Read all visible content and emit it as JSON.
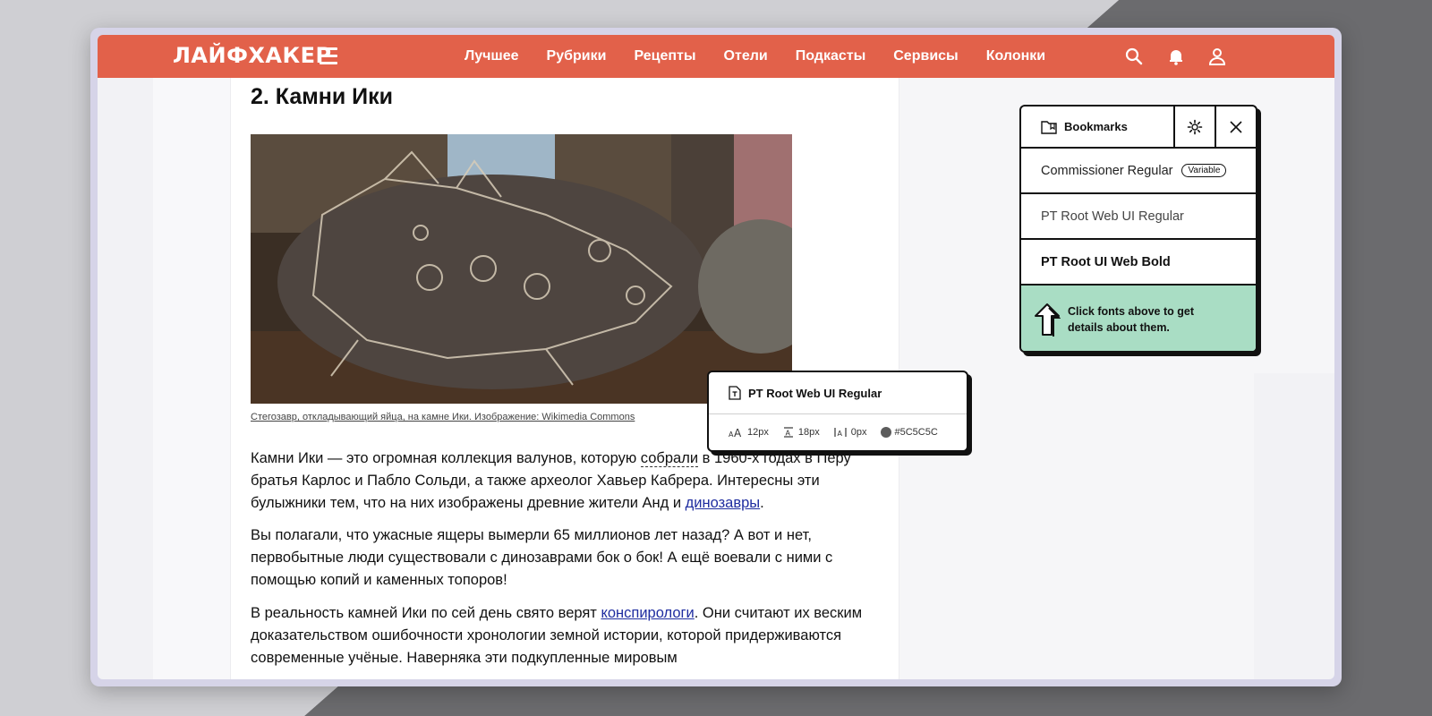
{
  "header": {
    "logo": "ЛАЙФХАКЕР",
    "nav": [
      "Лучшее",
      "Рубрики",
      "Рецепты",
      "Отели",
      "Подкасты",
      "Сервисы",
      "Колонки"
    ],
    "icons": [
      "search-icon",
      "bell-icon",
      "user-icon"
    ],
    "brand_color": "#e2614a"
  },
  "article": {
    "heading": "2. Камни Ики",
    "caption": "Стегозавр, откладывающий яйца, на камне Ики. Изображение: Wikimedia Commons",
    "p1": {
      "a": "Камни Ики — это огромная коллекция валунов, которую ",
      "dotted": "собрали",
      "b": " в 1960-х годах в Перу братья Карлос и Пабло Сольди, а также археолог Хавьер Кабрера. Интересны эти булыжники тем, что на них изображены древние жители Анд и ",
      "link": "динозавры",
      "c": "."
    },
    "p2": "Вы полагали, что ужасные ящеры вымерли 65 миллионов лет назад? А вот и нет, первобытные люди существовали с динозаврами бок о бок! А ещё воевали с ними с помощью копий и каменных топоров!",
    "p3": {
      "a": "В реальность камней Ики по сей день свято верят ",
      "link": "конспирологи",
      "b": ". Они считают их веским доказательством ошибочности хронологии земной истории, которой придерживаются современные учёные. Наверняка эти подкупленные мировым"
    }
  },
  "tooltip": {
    "font_name": "PT Root Web UI Regular",
    "size": "12px",
    "line_height": "18px",
    "letter_spacing": "0px",
    "color": "#5C5C5C"
  },
  "bookmarks": {
    "title": "Bookmarks",
    "fonts": [
      {
        "name": "Commissioner Regular",
        "badge": "Variable"
      },
      {
        "name": "PT Root Web UI Regular"
      },
      {
        "name": "PT Root UI Web Bold"
      }
    ],
    "hint": "Click fonts above to get details about them.",
    "hint_color": "#a9ddc4"
  }
}
